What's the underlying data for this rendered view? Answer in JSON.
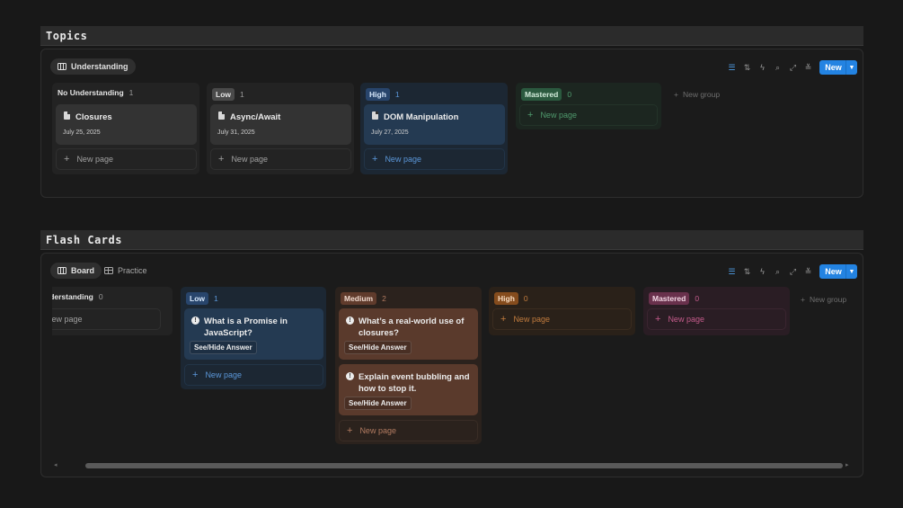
{
  "topics": {
    "title": "Topics",
    "view_tab": "Understanding",
    "new_button": "New",
    "new_group": "New group",
    "columns": [
      {
        "name": "No Understanding",
        "count": "1",
        "card": {
          "title": "Closures",
          "date": "July 25, 2025"
        },
        "new_page": "New page"
      },
      {
        "name": "Low",
        "count": "1",
        "card": {
          "title": "Async/Await",
          "date": "July 31, 2025"
        },
        "new_page": "New page"
      },
      {
        "name": "High",
        "count": "1",
        "card": {
          "title": "DOM Manipulation",
          "date": "July 27, 2025"
        },
        "new_page": "New page"
      },
      {
        "name": "Mastered",
        "count": "0",
        "new_page": "New page"
      }
    ]
  },
  "flash_cards": {
    "title": "Flash Cards",
    "tabs": [
      "Board",
      "Practice"
    ],
    "new_button": "New",
    "new_group": "New group",
    "columns": [
      {
        "name": "nderstanding",
        "count": "0",
        "new_page": "New page"
      },
      {
        "name": "Low",
        "count": "1",
        "cards": [
          {
            "title_line1": "What is a Promise in",
            "title_line2": "JavaScript?",
            "button": "See/Hide Answer"
          }
        ],
        "new_page": "New page"
      },
      {
        "name": "Medium",
        "count": "2",
        "cards": [
          {
            "title_line1": "What’s a real-world use of",
            "title_line2": "closures?",
            "button": "See/Hide Answer"
          },
          {
            "title_line1": "Explain event bubbling and",
            "title_line2": "how to stop it.",
            "button": "See/Hide Answer"
          }
        ],
        "new_page": "New page"
      },
      {
        "name": "High",
        "count": "0",
        "new_page": "New page"
      },
      {
        "name": "Mastered",
        "count": "0",
        "new_page": "New page"
      }
    ]
  },
  "colors": {
    "accent": "#2383e2",
    "low": "#4a4a4a",
    "high_blue": "#28456c",
    "mastered_green": "#2b593f",
    "medium_brown": "#603b2c",
    "high_orange": "#854c1d",
    "mastered_pink": "#69314c"
  }
}
